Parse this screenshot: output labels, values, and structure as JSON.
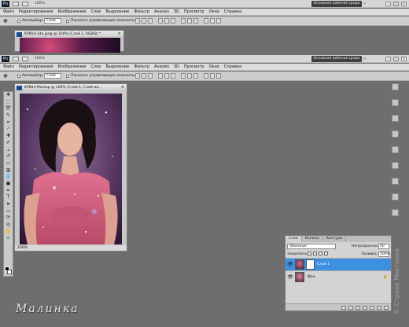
{
  "colors": {
    "workspace_bg": "#6e6e6e",
    "selected_layer": "#3d8fe0",
    "workspace_button": "#3f3f3f"
  },
  "app": {
    "logo": "Ps",
    "zoom": "100%",
    "workspace_button": "Основная рабочая среда",
    "workspace_arrow": "»",
    "window_buttons": [
      "–",
      "□",
      "×"
    ]
  },
  "menu": [
    "Файл",
    "Редактирование",
    "Изображение",
    "Слои",
    "Выделение",
    "Фильтр",
    "Анализ",
    "3D",
    "Просмотр",
    "Окно",
    "Справка"
  ],
  "options": {
    "autoselect_label": "Автовыбор:",
    "autoselect_value": "Слой",
    "show_controls_label": "Показать управляющие элементы"
  },
  "doc_back": {
    "title": "KP664-14a.jpeg @ 100% (Слой 1, RGB/8) *"
  },
  "doc_front": {
    "title": "KP664-Markup @ 100% (Слой 1, Слой-ма...",
    "status": "100%"
  },
  "layers_panel": {
    "tabs": [
      "Слои",
      "Каналы",
      "Контуры"
    ],
    "blend_mode": "Обычные",
    "opacity_label": "Непрозрачность:",
    "opacity_value": "50",
    "lock_label": "Закрепить:",
    "fill_label": "Заливка:",
    "fill_value": "100%",
    "layers": [
      {
        "name": "Слой 1",
        "selected": true
      },
      {
        "name": "Фон",
        "selected": false
      }
    ]
  },
  "signature": "Малинка",
  "watermark": "© Страна Мастеров"
}
